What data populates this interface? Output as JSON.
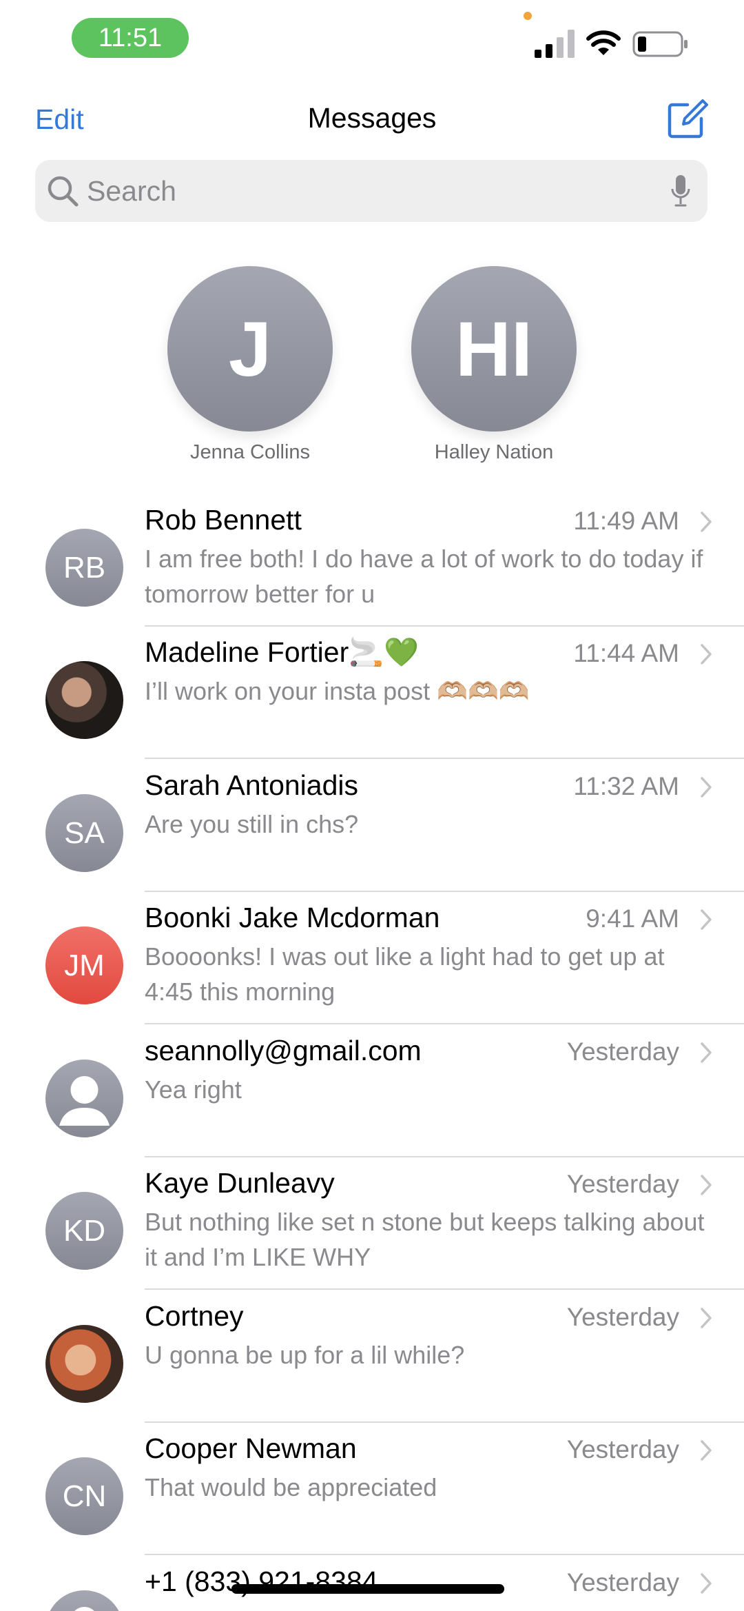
{
  "status": {
    "time": "11:51"
  },
  "nav": {
    "edit_label": "Edit",
    "title": "Messages"
  },
  "search": {
    "placeholder": "Search"
  },
  "pinned": [
    {
      "initials": "J",
      "name": "Jenna Collins"
    },
    {
      "initials": "HI",
      "name": "Halley Nation"
    }
  ],
  "conversations": [
    {
      "name": "Rob Bennett",
      "time": "11:49 AM",
      "preview": "I am free both! I do have a lot of work to do today if tomorrow better for u",
      "initials": "RB",
      "avatar_color": "#979aa5"
    },
    {
      "name": "Madeline Fortier🚬💚",
      "time": "11:44 AM",
      "preview": "I’ll work on your insta post 🫶🏼🫶🏼🫶🏼",
      "initials": "",
      "avatar_type": "photo"
    },
    {
      "name": "Sarah Antoniadis",
      "time": "11:32 AM",
      "preview": "Are you still in chs?",
      "initials": "SA",
      "avatar_color": "#979aa5"
    },
    {
      "name": "Boonki Jake Mcdorman",
      "time": "9:41 AM",
      "preview": "Boooonks! I was out like a light had to get up at 4:45 this morning",
      "initials": "JM",
      "avatar_color": "#e9584f"
    },
    {
      "name": "seannolly@gmail.com",
      "time": "Yesterday",
      "preview": "Yea right",
      "initials": "",
      "avatar_type": "person"
    },
    {
      "name": "Kaye Dunleavy",
      "time": "Yesterday",
      "preview": "But nothing like set n stone but keeps talking about it and I’m LIKE WHY",
      "initials": "KD",
      "avatar_color": "#979aa5"
    },
    {
      "name": "Cortney",
      "time": "Yesterday",
      "preview": "U gonna be up for a lil while?",
      "initials": "",
      "avatar_type": "photo"
    },
    {
      "name": "Cooper  Newman",
      "time": "Yesterday",
      "preview": "That would be appreciated",
      "initials": "CN",
      "avatar_color": "#979aa5"
    },
    {
      "name": "+1 (833) 921-8384",
      "time": "Yesterday",
      "preview": "",
      "initials": "",
      "avatar_type": "person"
    }
  ],
  "colors": {
    "accent": "#3478d8",
    "status_pill": "#5cc35f"
  }
}
